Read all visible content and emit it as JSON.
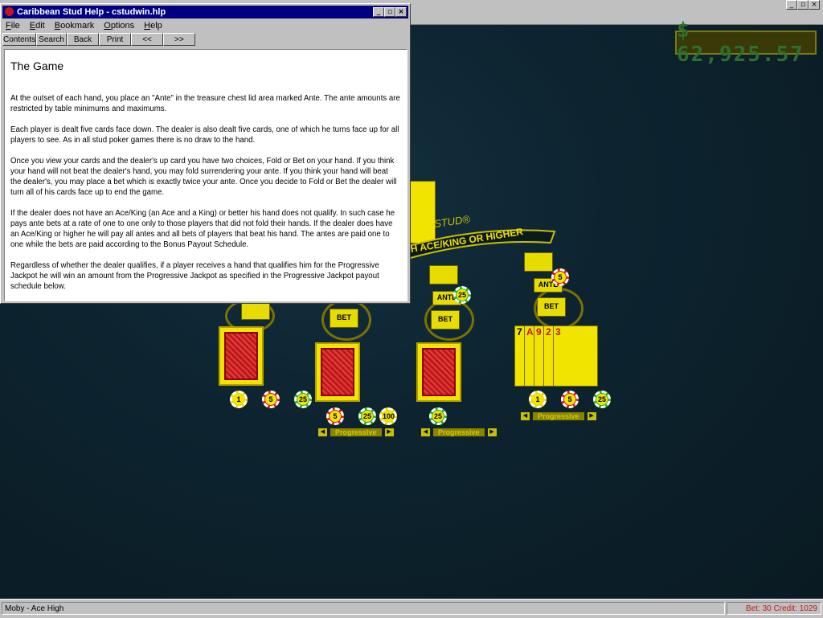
{
  "game_window": {
    "controls": [
      "_",
      "▫",
      "×"
    ],
    "credit_display": "$ 62,925.57"
  },
  "table": {
    "banner": "H ACE/KING OR HIGHER",
    "stud_logo": "STUD®",
    "bet_labels": [
      "BET",
      "BET",
      "BET",
      "BET"
    ],
    "ante_labels": [
      "ANTE",
      "ANTE"
    ],
    "chips": {
      "seat1": [
        "1",
        "5",
        "25"
      ],
      "seat2": [
        "5",
        "25",
        "100"
      ],
      "seat3": [
        "25"
      ],
      "seat4": [
        "1",
        "5",
        "25"
      ],
      "ante_chip_left": "25",
      "ante_chip_right": "5"
    },
    "progressive_label": "Progressive",
    "face_cards": [
      "7",
      "A",
      "9",
      "2",
      "3"
    ]
  },
  "status_bar": {
    "left": "Moby - Ace High",
    "right": "Bet: 30  Credit: 1029"
  },
  "help_window": {
    "title": "Caribbean Stud Help - cstudwin.hlp",
    "menu": [
      "File",
      "Edit",
      "Bookmark",
      "Options",
      "Help"
    ],
    "toolbar": [
      "Contents",
      "Search",
      "Back",
      "Print",
      "<<",
      ">>"
    ],
    "heading": "The Game",
    "paragraphs": [
      "At the outset of each hand, you place an  \"Ante\"  in the treasure chest lid area marked Ante.  The ante amounts are restricted by table minimums and maximums.",
      "Each player is dealt five cards face down.  The dealer is also dealt five cards, one of which he turns face up for all players to see.  As in all stud poker games there is no draw to the hand.",
      "Once you view your cards and the dealer's up card you have two choices, Fold or Bet on your hand.  If you think your hand will not beat the dealer's hand, you may fold surrendering your ante.  If you think your hand will beat the dealer's, you may place a bet which is exactly twice your ante.  Once you decide to Fold or Bet the dealer will turn all of his cards face up to end the game.",
      "If the dealer does not have an Ace/King (an Ace and a King) or better his hand does not qualify.  In such case he pays ante bets at a rate of one to one only to those players that did not fold their hands.  If the dealer does have an Ace/King or higher he will pay all antes and all bets of players that beat his hand.  The antes are paid one to one while the bets are paid according to the Bonus Payout Schedule.",
      "Regardless of whether the dealer qualifies, if a player receives a hand that qualifies him for the Progressive Jackpot he will win an amount from the Progressive Jackpot as specified in the Progressive Jackpot payout schedule below."
    ]
  }
}
